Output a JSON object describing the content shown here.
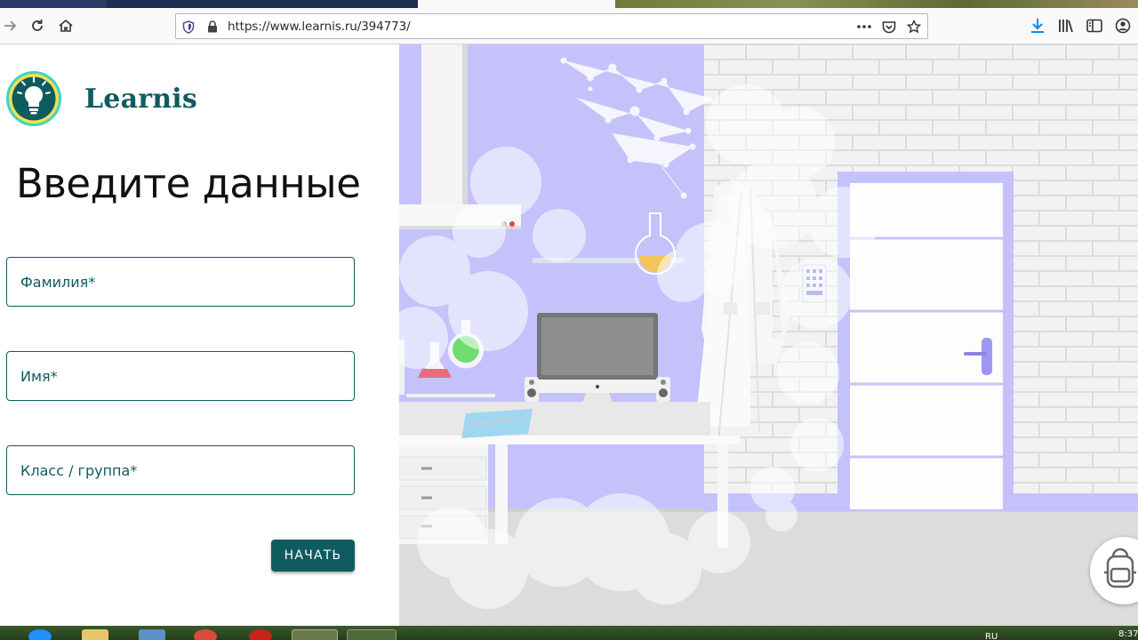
{
  "browser": {
    "url": "https://www.learnis.ru/394773/"
  },
  "app": {
    "brand": "Learnis",
    "heading": "Введите данные",
    "fields": [
      {
        "label": "Фамилия*"
      },
      {
        "label": "Имя*"
      },
      {
        "label": "Класс / группа*"
      }
    ],
    "start_label": "НАЧАТЬ",
    "accent_color": "#0e5c60"
  },
  "icons": {
    "back": "arrow-right-icon",
    "reload": "reload-icon",
    "home": "home-icon",
    "shield": "shield-icon",
    "lock": "lock-icon",
    "menu": "more-icon",
    "pocket": "pocket-icon",
    "bookmark": "star-icon",
    "download": "download-icon",
    "library": "library-icon",
    "sidebar": "sidebar-icon",
    "account": "account-icon",
    "help": "backpack-icon"
  },
  "taskbar": {
    "lang": "RU",
    "time": "8:37"
  }
}
